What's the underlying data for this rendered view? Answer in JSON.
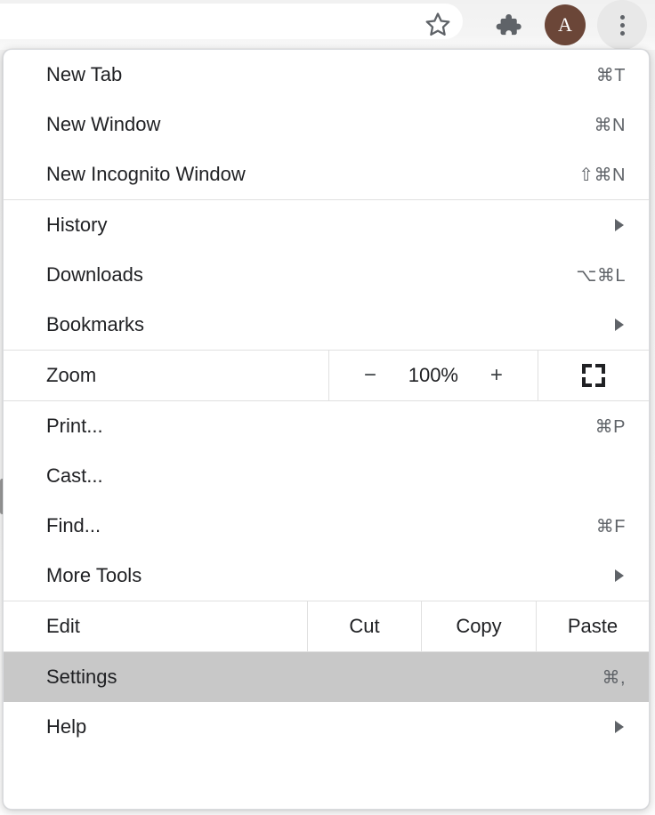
{
  "toolbar": {
    "bookmark_star": "bookmark-star",
    "extensions": "extensions-puzzle",
    "profile_initial": "A",
    "menu": "three-dot-menu"
  },
  "menu": {
    "sections": [
      {
        "name": "new",
        "items": [
          {
            "label": "New Tab",
            "shortcut": "⌘T"
          },
          {
            "label": "New Window",
            "shortcut": "⌘N"
          },
          {
            "label": "New Incognito Window",
            "shortcut": "⇧⌘N"
          }
        ]
      },
      {
        "name": "browsing",
        "items": [
          {
            "label": "History",
            "shortcut": "",
            "submenu": true
          },
          {
            "label": "Downloads",
            "shortcut": "⌥⌘L"
          },
          {
            "label": "Bookmarks",
            "shortcut": "",
            "submenu": true
          }
        ]
      },
      {
        "name": "tools",
        "items": [
          {
            "label": "Print...",
            "shortcut": "⌘P"
          },
          {
            "label": "Cast...",
            "shortcut": ""
          },
          {
            "label": "Find...",
            "shortcut": "⌘F"
          },
          {
            "label": "More Tools",
            "shortcut": "",
            "submenu": true
          }
        ]
      },
      {
        "name": "preferences",
        "items": [
          {
            "label": "Settings",
            "shortcut": "⌘,",
            "selected": true
          },
          {
            "label": "Help",
            "shortcut": "",
            "submenu": true
          }
        ]
      }
    ],
    "zoom_row": {
      "label": "Zoom",
      "minus": "−",
      "level": "100%",
      "plus": "+",
      "fullscreen_icon": "fullscreen-icon"
    },
    "edit_row": {
      "label": "Edit",
      "cut": "Cut",
      "copy": "Copy",
      "paste": "Paste"
    },
    "highlight_color": "#c8c8c8",
    "text_color": "#202124",
    "shortcut_color": "#5f6368"
  }
}
